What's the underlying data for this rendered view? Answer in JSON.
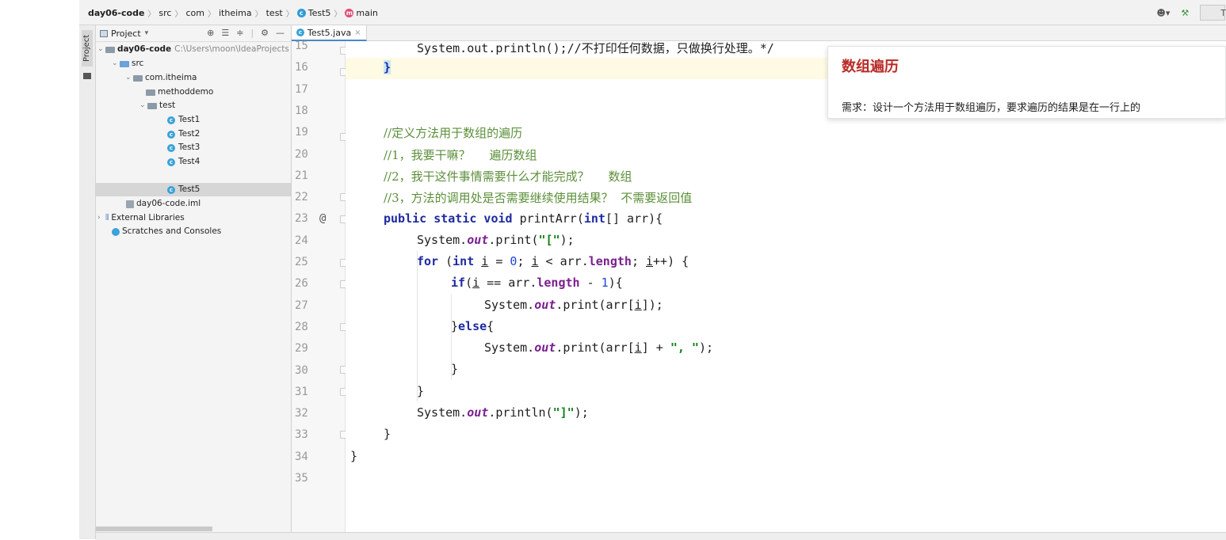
{
  "breadcrumb": {
    "project": "day06-code",
    "src": "src",
    "com": "com",
    "pkg": "itheima",
    "test": "test",
    "cls": "Test5",
    "method": "main"
  },
  "toolbar": {
    "icons": [
      "user-icon",
      "hammer-icon",
      "box-icon"
    ],
    "extra": "T"
  },
  "stripe": {
    "label": "Project"
  },
  "project_panel": {
    "title": "Project",
    "dropdown": "▾",
    "tree": {
      "root_name": "day06-code",
      "root_path": "C:\\Users\\moon\\IdeaProjects",
      "src": "src",
      "pkg": "com.itheima",
      "methoddemo": "methoddemo",
      "test": "test",
      "test1": "Test1",
      "test2": "Test2",
      "test3": "Test3",
      "test4": "Test4",
      "test5": "Test5",
      "iml": "day06-code.iml",
      "ext": "External Libraries",
      "scratch": "Scratches and Consoles"
    }
  },
  "tab": {
    "label": "Test5.java"
  },
  "editor": {
    "line_numbers": [
      "15",
      "16",
      "17",
      "18",
      "19",
      "20",
      "21",
      "22",
      "23",
      "24",
      "25",
      "26",
      "27",
      "28",
      "29",
      "30",
      "31",
      "32",
      "33",
      "34",
      "35"
    ],
    "l15": "System.out.println();//不打印任何数据，只做换行处理。*/",
    "l16": "}",
    "l19": "//定义方法用于数组的遍历",
    "l20": "//1，我要干嘛？     遍历数组",
    "l21": "//2，我干这件事情需要什么才能完成？     数组",
    "l22": "//3，方法的调用处是否需要继续使用结果？  不需要返回值",
    "gutter_at": "@"
  },
  "popup": {
    "title": "数组遍历",
    "body": "需求：设计一个方法用于数组遍历，要求遍历的结果是在一行上的"
  }
}
